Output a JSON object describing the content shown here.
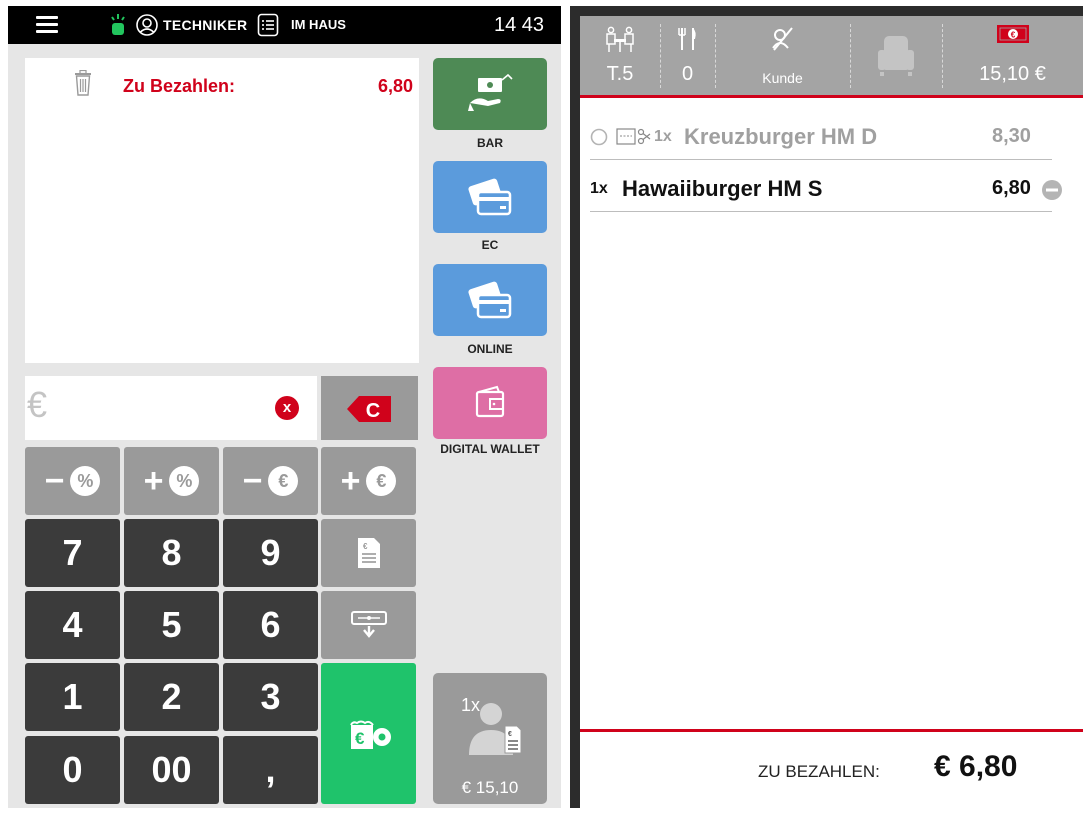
{
  "topbar": {
    "user": "TECHNIKER",
    "mode": "IM HAUS",
    "time": "14 43"
  },
  "payment": {
    "due_label": "Zu Bezahlen:",
    "due_value": "6,80",
    "amount_placeholder": "€",
    "clear_label": "x",
    "c_label": "C"
  },
  "methods": [
    {
      "label": "BAR",
      "color": "#4e8a55"
    },
    {
      "label": "EC",
      "color": "#5b9bdc"
    },
    {
      "label": "ONLINE",
      "color": "#5b9bdc"
    },
    {
      "label": "DIGITAL WALLET",
      "color": "#de6ea5"
    }
  ],
  "keypad": {
    "adjust": [
      "−",
      "+",
      "−",
      "+"
    ],
    "adjust_symbols": [
      "%",
      "%",
      "€",
      "€"
    ],
    "digits": [
      "7",
      "8",
      "9",
      "4",
      "5",
      "6",
      "1",
      "2",
      "3",
      "0",
      "00",
      ","
    ]
  },
  "split": {
    "count": "1x",
    "total": "€ 15,10"
  },
  "order_header": {
    "table": "T.5",
    "guests": "0",
    "customer": "Kunde",
    "total": "15,10 €"
  },
  "order_lines": [
    {
      "qty": "1x",
      "name": "Kreuzburger HM D",
      "price": "8,30",
      "status": "paid-split"
    },
    {
      "qty": "1x",
      "name": "Hawaiiburger HM S",
      "price": "6,80",
      "status": "open"
    }
  ],
  "footer": {
    "label": "ZU BEZAHLEN:",
    "total": "€ 6,80"
  },
  "colors": {
    "accent_red": "#d0021b",
    "pay_green": "#1fc36b",
    "key_dark": "#3b3b3b",
    "key_gray": "#9a9a9a"
  }
}
